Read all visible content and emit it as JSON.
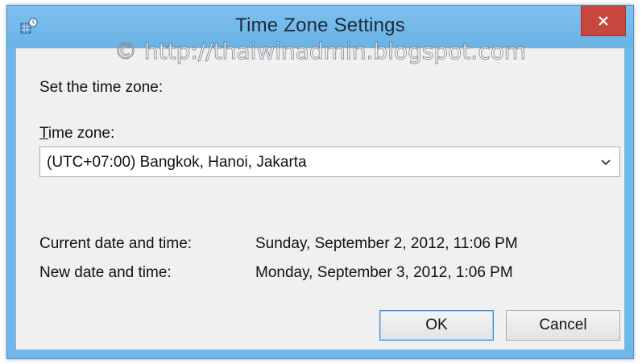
{
  "window": {
    "title": "Time Zone Settings",
    "watermark": "© http://thaiwinadmin.blogspot.com",
    "app_icon": "time-zone-globe-icon",
    "close_icon": "close-icon"
  },
  "form": {
    "set_label": "Set the time zone:",
    "timezone_label_accel": "T",
    "timezone_label_rest": "ime zone:",
    "timezone_value": "(UTC+07:00) Bangkok, Hanoi, Jakarta",
    "dropdown_icon": "chevron-down-icon",
    "current_label": "Current date and time:",
    "current_value": "Sunday, September 2, 2012, 11:06 PM",
    "new_label": "New date and time:",
    "new_value": "Monday, September 3, 2012, 1:06 PM"
  },
  "buttons": {
    "ok": "OK",
    "cancel": "Cancel"
  },
  "colors": {
    "titlebar": "#6ab3e6",
    "close_button": "#c7463d",
    "client_background": "#f0f0f0",
    "default_button_border": "#3c8fd8"
  }
}
